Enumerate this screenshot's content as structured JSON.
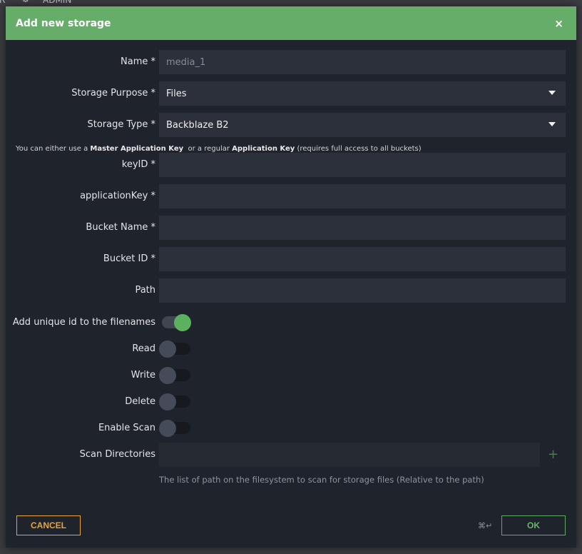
{
  "background": {
    "nav_left_fragment": "R",
    "admin_label": "ADMIN",
    "admin_icon": "gears-icon"
  },
  "dialog": {
    "title": "Add new storage",
    "close_label": "×",
    "header_color": "#66ad6a",
    "fields": {
      "name": {
        "label": "Name *",
        "placeholder": "media_1",
        "value": ""
      },
      "storage_purpose": {
        "label": "Storage Purpose *",
        "value": "Files"
      },
      "storage_type": {
        "label": "Storage Type *",
        "value": "Backblaze B2"
      },
      "key_hint": {
        "prefix": "You can either use a ",
        "bold1": "Master Application Key",
        "middle": "  or a regular ",
        "bold2": "Application Key",
        "suffix": " (requires full access to all buckets)"
      },
      "key_id": {
        "label": "keyID *",
        "value": ""
      },
      "application_key": {
        "label": "applicationKey *",
        "value": ""
      },
      "bucket_name": {
        "label": "Bucket Name *",
        "value": ""
      },
      "bucket_id": {
        "label": "Bucket ID *",
        "value": ""
      },
      "path": {
        "label": "Path",
        "value": ""
      }
    },
    "toggles": [
      {
        "label": "Add unique id to the filenames",
        "on": true
      },
      {
        "label": "Read",
        "on": false
      },
      {
        "label": "Write",
        "on": false
      },
      {
        "label": "Delete",
        "on": false
      },
      {
        "label": "Enable Scan",
        "on": false
      }
    ],
    "scan_directories": {
      "label": "Scan Directories",
      "add_icon": "+",
      "hint": "The list of path on the filesystem to scan for storage files (Relative to the path)"
    },
    "footer": {
      "cancel_label": "CANCEL",
      "ok_label": "OK",
      "shortcut_hint": "⌘↵",
      "cancel_color": "#e6a43a",
      "ok_color": "#6ab46d"
    }
  }
}
